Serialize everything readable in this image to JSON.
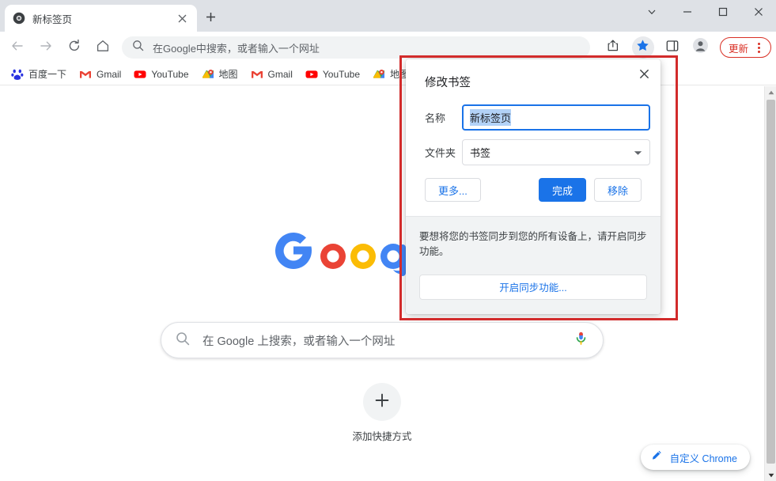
{
  "window": {
    "controls": [
      {
        "name": "tab-search-button",
        "icon": "chevron-down-icon"
      },
      {
        "name": "minimize-button",
        "icon": "minimize-icon"
      },
      {
        "name": "maximize-button",
        "icon": "maximize-icon"
      },
      {
        "name": "close-button",
        "icon": "close-icon"
      }
    ]
  },
  "tab": {
    "title": "新标签页",
    "favicon": "chrome-icon",
    "close_icon": "close-icon",
    "newtab_icon": "plus-icon"
  },
  "toolbar": {
    "back_icon": "back-arrow-icon",
    "forward_icon": "forward-arrow-icon",
    "reload_icon": "reload-icon",
    "home_icon": "home-icon",
    "omnibox": {
      "search_icon": "search-icon",
      "placeholder": "在Google中搜索，或者输入一个网址",
      "value": ""
    },
    "share_icon": "share-icon",
    "star_icon": "star-filled-icon",
    "side_panel_icon": "side-panel-icon",
    "profile_icon": "profile-avatar-icon",
    "update_label": "更新",
    "menu_icon": "three-dot-menu-icon",
    "accent_red": "#d93025",
    "accent_blue": "#1a73e8"
  },
  "bookmarks_bar": {
    "items": [
      {
        "label": "百度一下",
        "icon": "baidu-icon"
      },
      {
        "label": "Gmail",
        "icon": "gmail-icon"
      },
      {
        "label": "YouTube",
        "icon": "youtube-icon"
      },
      {
        "label": "地图",
        "icon": "google-maps-icon"
      },
      {
        "label": "Gmail",
        "icon": "gmail-icon"
      },
      {
        "label": "YouTube",
        "icon": "youtube-icon"
      },
      {
        "label": "地图",
        "icon": "google-maps-icon"
      }
    ]
  },
  "new_tab_page": {
    "logo_alt": "Google",
    "search": {
      "search_icon": "search-icon",
      "placeholder": "在 Google 上搜索，或者输入一个网址",
      "mic_icon": "microphone-icon"
    },
    "shortcut": {
      "add_icon": "plus-icon",
      "label": "添加快捷方式"
    },
    "customize": {
      "icon": "pencil-icon",
      "label": "自定义 Chrome"
    }
  },
  "scrollbar": {
    "up_icon": "scroll-up-arrow-icon",
    "down_icon": "scroll-down-arrow-icon"
  },
  "bookmark_dialog": {
    "title": "修改书签",
    "close_icon": "close-icon",
    "name_label": "名称",
    "name_value": "新标签页",
    "folder_label": "文件夹",
    "folder_value": "书签",
    "folder_caret_icon": "chevron-down-icon",
    "more_label": "更多...",
    "done_label": "完成",
    "remove_label": "移除",
    "sync_message": "要想将您的书签同步到您的所有设备上，请开启同步功能。",
    "sync_button_label": "开启同步功能...",
    "highlight_color": "#d22b2b"
  }
}
